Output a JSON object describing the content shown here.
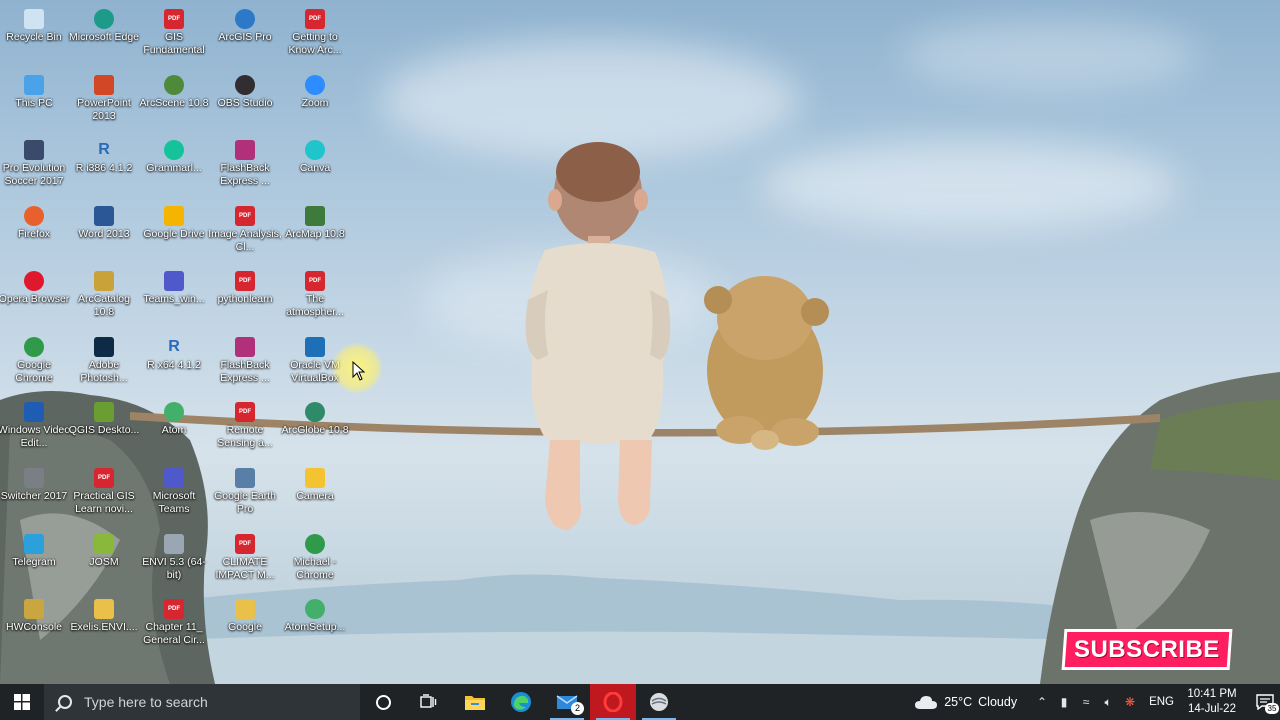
{
  "desktop": {
    "icons": [
      {
        "label": "Recycle Bin",
        "icon": "recycle-bin-icon",
        "color": "#cfe3f3"
      },
      {
        "label": "This PC",
        "icon": "pc-icon",
        "color": "#4aa3e8"
      },
      {
        "label": "Pro Evolution Soccer 2017",
        "icon": "game-icon",
        "color": "#3a4a6a"
      },
      {
        "label": "Firefox",
        "icon": "firefox-icon",
        "color": "#e8602c"
      },
      {
        "label": "Opera Browser",
        "icon": "opera-icon",
        "color": "#e0182d"
      },
      {
        "label": "Google Chrome",
        "icon": "chrome-icon",
        "color": "#2f9a4a"
      },
      {
        "label": "Windows Video Edit...",
        "icon": "video-editor-icon",
        "color": "#1f5db5"
      },
      {
        "label": "Switcher 2017",
        "icon": "switcher-icon",
        "color": "#7a7f86"
      },
      {
        "label": "Telegram",
        "icon": "telegram-icon",
        "color": "#2ba0da"
      },
      {
        "label": "HWConsole",
        "icon": "console-icon",
        "color": "#c9a640"
      },
      {
        "label": "Microsoft Edge",
        "icon": "edge-icon",
        "color": "#1e9a8a"
      },
      {
        "label": "PowerPoint 2013",
        "icon": "powerpoint-icon",
        "color": "#d24726"
      },
      {
        "label": "R i386 4.1.2",
        "icon": "r-icon",
        "color": "#2a6bb8"
      },
      {
        "label": "Word 2013",
        "icon": "word-icon",
        "color": "#2b5797"
      },
      {
        "label": "ArcCatalog 10.8",
        "icon": "arccatalog-icon",
        "color": "#c9a33a"
      },
      {
        "label": "Adobe Photosh...",
        "icon": "photoshop-icon",
        "color": "#0e2a47"
      },
      {
        "label": "QGIS Deskto...",
        "icon": "qgis-icon",
        "color": "#6a9d32"
      },
      {
        "label": "Practical GIS Learn novi...",
        "icon": "pdf-icon",
        "color": "#d6262f"
      },
      {
        "label": "JOSM",
        "icon": "josm-icon",
        "color": "#8ab83a"
      },
      {
        "label": "Exelis.ENVI....",
        "icon": "folder-icon",
        "color": "#e8c04a"
      },
      {
        "label": "GIS Fundamental",
        "icon": "pdf-icon",
        "color": "#d6262f"
      },
      {
        "label": "ArcScene 10.8",
        "icon": "arcscene-icon",
        "color": "#4f8a3a"
      },
      {
        "label": "Grammarl...",
        "icon": "grammarly-icon",
        "color": "#15c39a"
      },
      {
        "label": "Google Drive",
        "icon": "google-drive-icon",
        "color": "#f4b400"
      },
      {
        "label": "Teams_win...",
        "icon": "teams-icon",
        "color": "#5059c9"
      },
      {
        "label": "R x64 4.1.2",
        "icon": "r-icon",
        "color": "#2a6bb8"
      },
      {
        "label": "Atom",
        "icon": "atom-icon",
        "color": "#42b06a"
      },
      {
        "label": "Microsoft Teams",
        "icon": "teams-icon",
        "color": "#5059c9"
      },
      {
        "label": "ENVI 5.3 (64-bit)",
        "icon": "envi-icon",
        "color": "#9aa6b2"
      },
      {
        "label": "Chapter 11_ General Cir...",
        "icon": "pdf-icon",
        "color": "#d6262f"
      },
      {
        "label": "ArcGIS Pro",
        "icon": "arcgis-pro-icon",
        "color": "#2c79c8"
      },
      {
        "label": "OBS Studio",
        "icon": "obs-icon",
        "color": "#302e31"
      },
      {
        "label": "FlashBack Express ...",
        "icon": "flashback-icon",
        "color": "#b0307a"
      },
      {
        "label": "Image Analysis, Cl...",
        "icon": "pdf-icon",
        "color": "#d6262f"
      },
      {
        "label": "pythonlearn",
        "icon": "pdf-icon",
        "color": "#d6262f"
      },
      {
        "label": "FlashBack Express ...",
        "icon": "flashback-icon",
        "color": "#b0307a"
      },
      {
        "label": "Remote Sensing a...",
        "icon": "pdf-icon",
        "color": "#d6262f"
      },
      {
        "label": "Google Earth Pro",
        "icon": "google-earth-icon",
        "color": "#5a7fa6"
      },
      {
        "label": "CLIMATE IMPACT M...",
        "icon": "pdf-icon",
        "color": "#d6262f"
      },
      {
        "label": "Google",
        "icon": "folder-icon",
        "color": "#e8c04a"
      },
      {
        "label": "Getting to Know Arc...",
        "icon": "pdf-icon",
        "color": "#d6262f"
      },
      {
        "label": "Zoom",
        "icon": "zoom-icon",
        "color": "#2d8cff"
      },
      {
        "label": "Canva",
        "icon": "canva-icon",
        "color": "#20c4cb"
      },
      {
        "label": "ArcMap 10.8",
        "icon": "arcmap-icon",
        "color": "#3d7a3c"
      },
      {
        "label": "The atmospher...",
        "icon": "pdf-icon",
        "color": "#d6262f"
      },
      {
        "label": "Oracle VM VirtualBox",
        "icon": "virtualbox-icon",
        "color": "#1d6fb8"
      },
      {
        "label": "ArcGlobe 10.8",
        "icon": "arcglobe-icon",
        "color": "#2f8a6a"
      },
      {
        "label": "Camera",
        "icon": "camera-icon",
        "color": "#f4c430"
      },
      {
        "label": "Michael - Chrome",
        "icon": "chrome-icon",
        "color": "#2f9a4a"
      },
      {
        "label": "AtomSetup...",
        "icon": "atom-icon",
        "color": "#42b06a"
      }
    ]
  },
  "overlay": {
    "subscribe_label": "SUBSCRIBE"
  },
  "taskbar": {
    "search_placeholder": "Type here to search",
    "apps": [
      {
        "name": "cortana-icon"
      },
      {
        "name": "task-view-icon"
      },
      {
        "name": "file-explorer-icon"
      },
      {
        "name": "edge-icon"
      },
      {
        "name": "mail-icon",
        "badge": "2"
      },
      {
        "name": "opera-icon"
      },
      {
        "name": "arcgis-pro-icon"
      }
    ],
    "weather_temp": "25°C",
    "weather_text": "Cloudy",
    "language": "ENG",
    "time": "10:41 PM",
    "date": "14-Jul-22",
    "notification_count": "35"
  },
  "colors": {
    "taskbar_bg": "#1f2326",
    "subscribe_bg": "#ff1e5f",
    "accent": "#79b7ee"
  }
}
